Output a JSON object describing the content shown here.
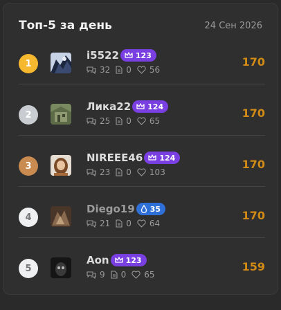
{
  "header": {
    "title": "Топ-5 за день",
    "date": "24 Сен 2026"
  },
  "colors": {
    "gold": "#f5b82e",
    "silver": "#c9ccd1",
    "bronze": "#c98b4f",
    "plain": "#eef0f2",
    "score": "#d08a15",
    "purple_badge": "#7a3fe0",
    "blue_badge": "#2f6fd8"
  },
  "rows": [
    {
      "rank": "1",
      "name": "i5522",
      "badge_icon": "crown-icon",
      "badge": "123",
      "comments": "32",
      "posts": "0",
      "likes": "56",
      "score": "170"
    },
    {
      "rank": "2",
      "name": "Лика22",
      "badge_icon": "crown-icon",
      "badge": "124",
      "comments": "25",
      "posts": "0",
      "likes": "65",
      "score": "170"
    },
    {
      "rank": "3",
      "name": "NIREEE46",
      "badge_icon": "crown-icon",
      "badge": "124",
      "comments": "23",
      "posts": "0",
      "likes": "103",
      "score": "170"
    },
    {
      "rank": "4",
      "name": "Diego19",
      "badge_icon": "drop-icon",
      "badge": "35",
      "comments": "21",
      "posts": "0",
      "likes": "64",
      "score": "170"
    },
    {
      "rank": "5",
      "name": "Aon",
      "badge_icon": "crown-icon",
      "badge": "123",
      "comments": "9",
      "posts": "0",
      "likes": "65",
      "score": "159"
    }
  ]
}
